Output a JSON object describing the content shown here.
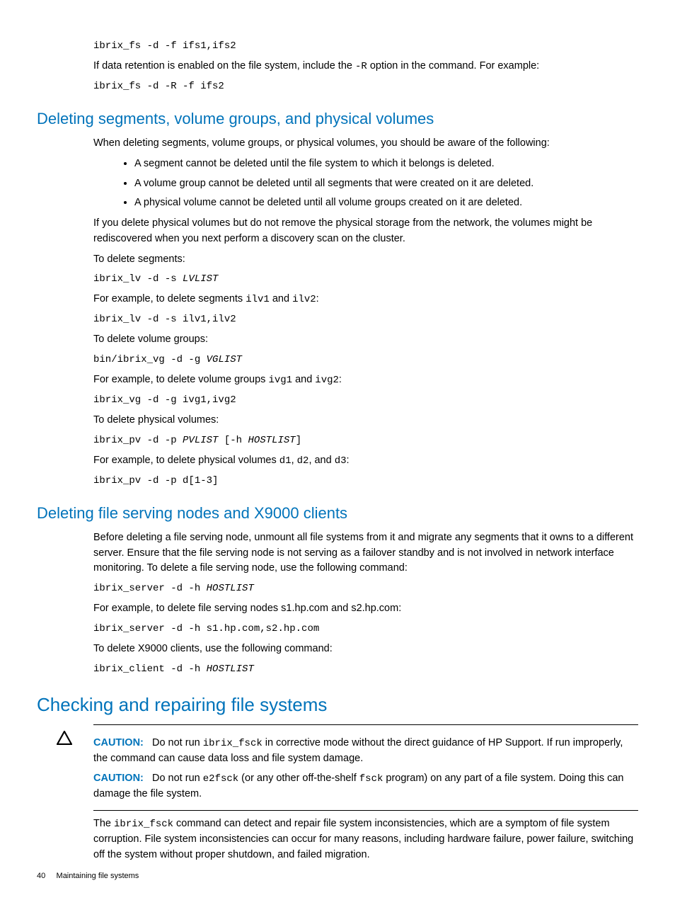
{
  "intro": {
    "code1": "ibrix_fs -d -f ifs1,ifs2",
    "text1a": "If data retention is enabled on the file system, include the ",
    "opt_R": "-R",
    "text1b": " option in the command. For example:",
    "code2": "ibrix_fs -d -R -f ifs2"
  },
  "section1": {
    "heading": "Deleting segments, volume groups, and physical volumes",
    "intro": "When deleting segments, volume groups, or physical volumes, you should be aware of the following:",
    "bullets": [
      "A segment cannot be deleted until the file system to which it belongs is deleted.",
      "A volume group cannot be deleted until all segments that were created on it are deleted.",
      "A physical volume cannot be deleted until all volume groups created on it are deleted."
    ],
    "warn": "If you delete physical volumes but do not remove the physical storage from the network, the volumes might be rediscovered when you next perform a discovery scan on the cluster.",
    "p1": "To delete segments:",
    "c1a": "ibrix_lv -d -s ",
    "c1b": "LVLIST",
    "p2a": "For example, to delete segments ",
    "m2a": "ilv1",
    "p2b": " and ",
    "m2b": "ilv2",
    "p2c": ":",
    "c2": "ibrix_lv -d -s ilv1,ilv2",
    "p3": "To delete volume groups:",
    "c3a": "bin/ibrix_vg -d -g ",
    "c3b": "VGLIST",
    "p4a": "For example, to delete volume groups ",
    "m4a": "ivg1",
    "p4b": " and ",
    "m4b": "ivg2",
    "p4c": ":",
    "c4": "ibrix_vg -d -g ivg1,ivg2",
    "p5": "To delete physical volumes:",
    "c5a": "ibrix_pv -d -p ",
    "c5b": "PVLIST",
    "c5c": " [-h ",
    "c5d": "HOSTLIST",
    "c5e": "]",
    "p6a": "For example, to delete physical volumes ",
    "m6a": "d1",
    "p6b": ", ",
    "m6b": "d2",
    "p6c": ", and ",
    "m6c": "d3",
    "p6d": ":",
    "c6": "ibrix_pv -d -p d[1-3]"
  },
  "section2": {
    "heading": "Deleting file serving nodes and X9000 clients",
    "intro": "Before deleting a file serving node, unmount all file systems from it and migrate any segments that it owns to a different server. Ensure that the file serving node is not serving as a failover standby and is not involved in network interface monitoring. To delete a file serving node, use the following command:",
    "c1a": "ibrix_server -d -h ",
    "c1b": "HOSTLIST",
    "p2": "For example, to delete file serving nodes s1.hp.com and s2.hp.com:",
    "c2": "ibrix_server -d -h s1.hp.com,s2.hp.com",
    "p3": "To delete X9000 clients, use the following command:",
    "c3a": "ibrix_client -d -h ",
    "c3b": "HOSTLIST"
  },
  "section3": {
    "heading": "Checking and repairing file systems",
    "caution1": {
      "label": "CAUTION:",
      "t1": "Do not run ",
      "m1": "ibrix_fsck",
      "t2": " in corrective mode without the direct guidance of HP Support. If run improperly, the command can cause data loss and file system damage."
    },
    "caution2": {
      "label": "CAUTION:",
      "t1": "Do not run ",
      "m1": "e2fsck",
      "t2": " (or any other off-the-shelf ",
      "m2": "fsck",
      "t3": " program) on any part of a file system. Doing this can damage the file system."
    },
    "body": {
      "t1": "The ",
      "m1": "ibrix_fsck",
      "t2": " command can detect and repair file system inconsistencies, which are a symptom of file system corruption. File system inconsistencies can occur for many reasons, including hardware failure, power failure, switching off the system without proper shutdown, and failed migration."
    }
  },
  "footer": {
    "page": "40",
    "title": "Maintaining file systems"
  }
}
